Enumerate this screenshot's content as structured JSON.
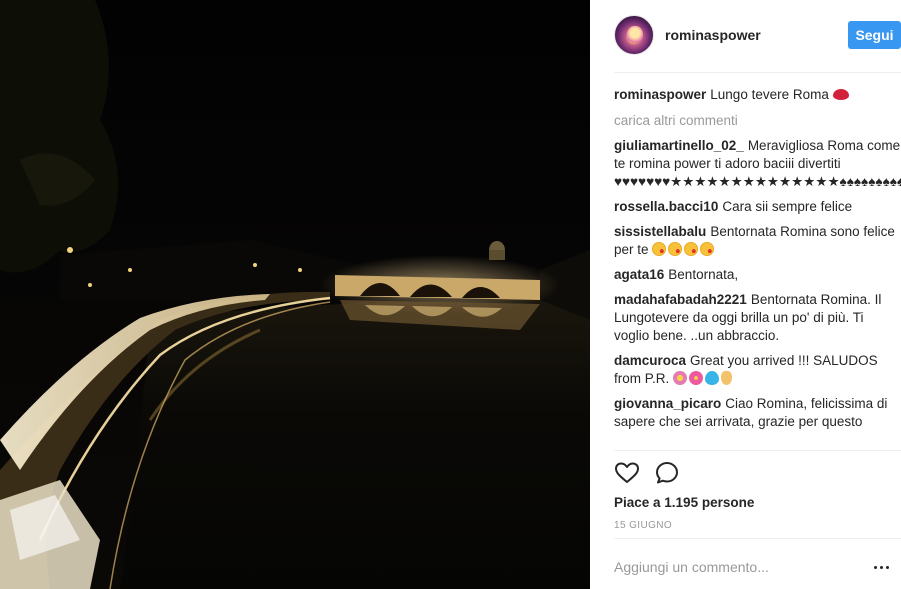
{
  "header": {
    "username": "rominaspower",
    "follow_label": "Segui"
  },
  "caption": {
    "user": "rominaspower",
    "text": "Lungo tevere Roma",
    "emoji": "kiss-lips-emoji"
  },
  "load_more_label": "carica altri commenti",
  "comments": [
    {
      "user": "giuliamartinello_02_",
      "text": "Meravigliosa Roma come te romina power ti adoro baciii divertiti ♥♥♥♥♥♥♥★★★★★★★★★★★★★★♠♠♠♠♠♠♠♠♠♠♠♠♠♠♠♠",
      "emoji": []
    },
    {
      "user": "rossella.bacci10",
      "text": "Cara sii sempre felice",
      "emoji": []
    },
    {
      "user": "sissistellabalu",
      "text": "Bentornata Romina sono felice per te",
      "emoji": [
        "kissing-face-emoji",
        "kissing-face-emoji",
        "kissing-face-emoji",
        "kissing-face-emoji"
      ]
    },
    {
      "user": "agata16",
      "text": "Bentornata,",
      "emoji": []
    },
    {
      "user": "madahafabadah2221",
      "text": "Bentornata Romina. Il Lungotevere da oggi brilla un po' di più. Ti voglio bene. ..un abbraccio.",
      "emoji": []
    },
    {
      "user": "damcuroca",
      "text": "Great you arrived !!! SALUDOS from P.R.",
      "emoji": [
        "flower-emoji",
        "hibiscus-emoji",
        "blue-heart-emoji",
        "victory-hand-emoji"
      ]
    },
    {
      "user": "giovanna_picaro",
      "text": "Ciao Romina, felicissima di sapere che sei arrivata, grazie per questo",
      "emoji": []
    }
  ],
  "actions": {
    "like_icon": "heart-outline-icon",
    "comment_icon": "speech-bubble-icon"
  },
  "likes_text": "Piace a 1.195 persone",
  "date_text": "15 GIUGNO",
  "comment_input": {
    "placeholder": "Aggiungi un commento..."
  },
  "more_icon": "ellipsis-icon",
  "colors": {
    "accent": "#3897f0",
    "text": "#262626",
    "muted": "#999999",
    "divider": "#efefef"
  }
}
